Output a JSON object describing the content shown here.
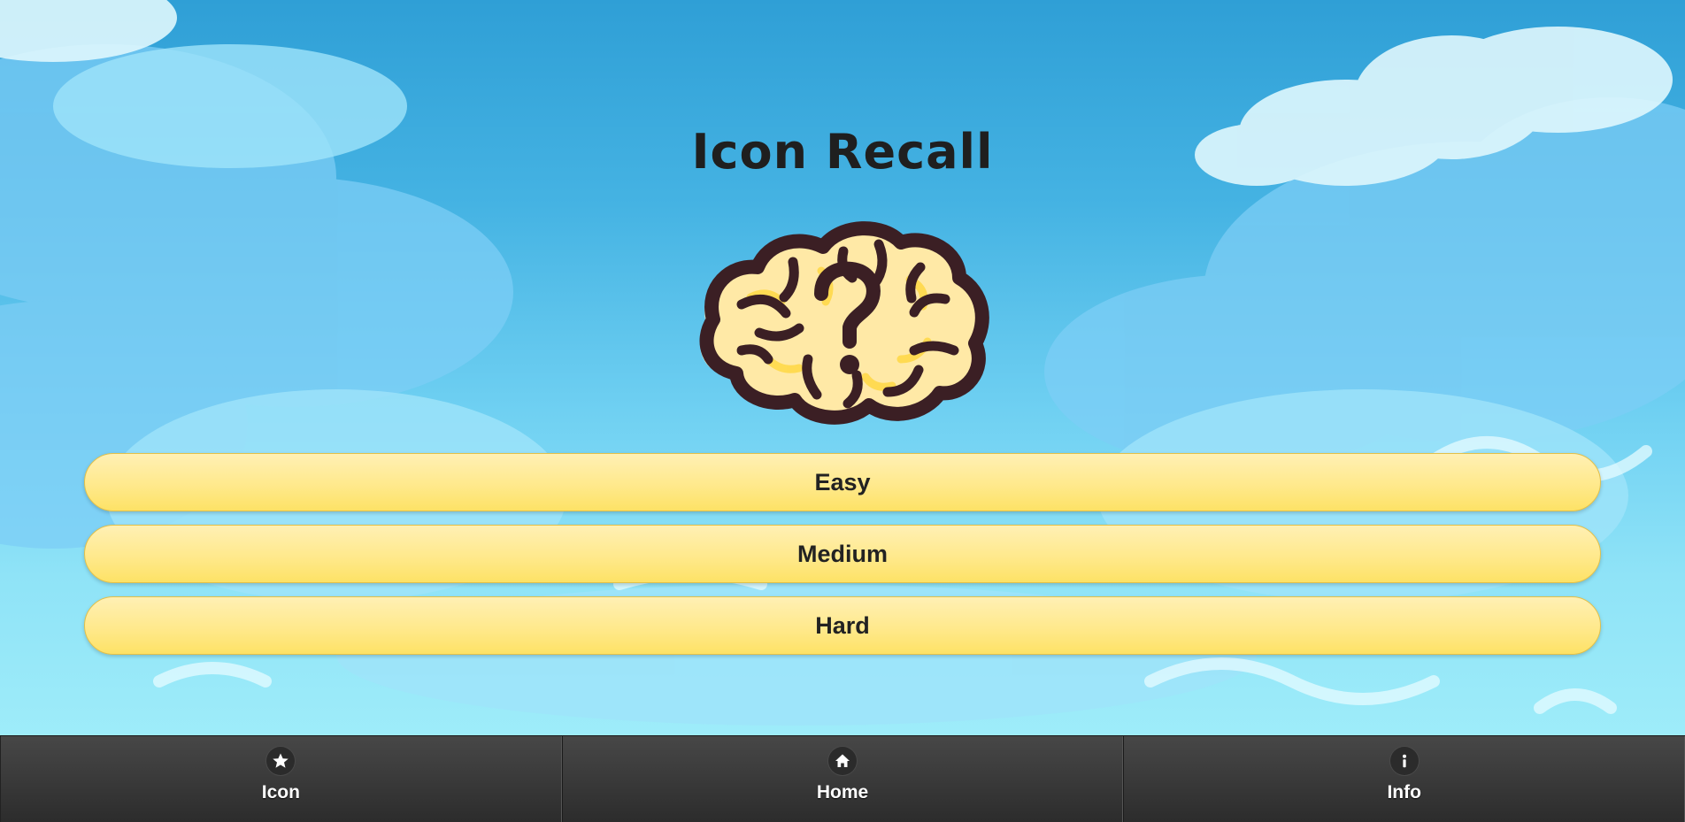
{
  "app": {
    "title": "Icon Recall"
  },
  "menu": {
    "levels": [
      {
        "label": "Easy"
      },
      {
        "label": "Medium"
      },
      {
        "label": "Hard"
      }
    ]
  },
  "tabbar": {
    "tabs": [
      {
        "label": "Icon",
        "icon": "star-icon"
      },
      {
        "label": "Home",
        "icon": "home-icon"
      },
      {
        "label": "Info",
        "icon": "info-icon"
      }
    ]
  },
  "colors": {
    "sky_top": "#2f9fd6",
    "sky_bottom": "#a6f1fb",
    "button_fill": "#ffe98c",
    "tabbar": "#3a3a3a",
    "brain_outline": "#3b1f24",
    "brain_fill": "#ffeaa8"
  }
}
